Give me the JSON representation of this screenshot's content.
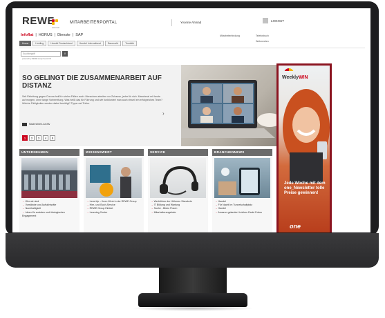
{
  "header": {
    "logo_text": "REWE",
    "logo_sub": "GROUP",
    "portal_title": "MITARBEITERPORTAL",
    "user_name": "Yvonne Ahmad",
    "logout_label": "LOGOUT"
  },
  "subnav": [
    "Infoflat",
    "HORUS",
    "Dienste",
    "SAP"
  ],
  "utility_links": [
    "Mitarbeiterbindung",
    "Telefonbuch",
    "Webmeeten"
  ],
  "tabs": [
    "Home",
    "Holding",
    "Handel Deutschland",
    "Handel International",
    "Baumarkt",
    "Touristik"
  ],
  "search": {
    "placeholder": "Suchbegriff",
    "hint": "powered by REWE Group Search ID"
  },
  "hero": {
    "title": "SO GELINGT DIE ZUSAMMENARBEIT AUF DISTANZ",
    "text": "Seit Einleitung gegen Corona heißt in vielen Fällen auch: Menschen arbeiten vor Zuhause, jeder für sich. Manchmal mit heute auf morgen, ohne lange Vorbereitung. Was heißt das für Führung und wie funktioniert man auch virtuell ein erfolgreiches Team? Welche Fähigkeiten werden dabei benötigt? Tipps und Tricks.",
    "more_label": "Nachrichten-Archiv",
    "pages": [
      "1",
      "2",
      "3",
      "4",
      "5"
    ]
  },
  "cards": [
    {
      "title": "UNTERNEHMEN",
      "items": [
        "Wer wir sind",
        "Vorstände und Aufsichtsräte",
        "Nachhaltigkeit",
        "Ideen für sozialen und ökologischen Engagement"
      ]
    },
    {
      "title": "WISSENSWERT",
      "items": [
        "LeverUp – Ihren Werk in der REWE Group",
        "Hier- und Buch-Service",
        "REWE Group Einfaxt",
        "Learning Center"
      ]
    },
    {
      "title": "SERVICE",
      "items": [
        "Werkführer der Höheren Standorte",
        "IT Bildung und Wartung",
        "Suche - Bistro Posen",
        "Mitarbeiterangebote"
      ]
    },
    {
      "title": "BRANCHENNEWS",
      "items": [
        "Handel",
        "Für Nacht Im Tunnelschaltplatz",
        "Handel",
        "Amazon gelandert Leichen Exakt Fokus"
      ]
    }
  ],
  "ad": {
    "brand": "Weekly",
    "brand_bold": "WIN",
    "text": "Jede Woche mit dem one_Newsletter tolle Preise gewinnen!",
    "logo": "one"
  }
}
